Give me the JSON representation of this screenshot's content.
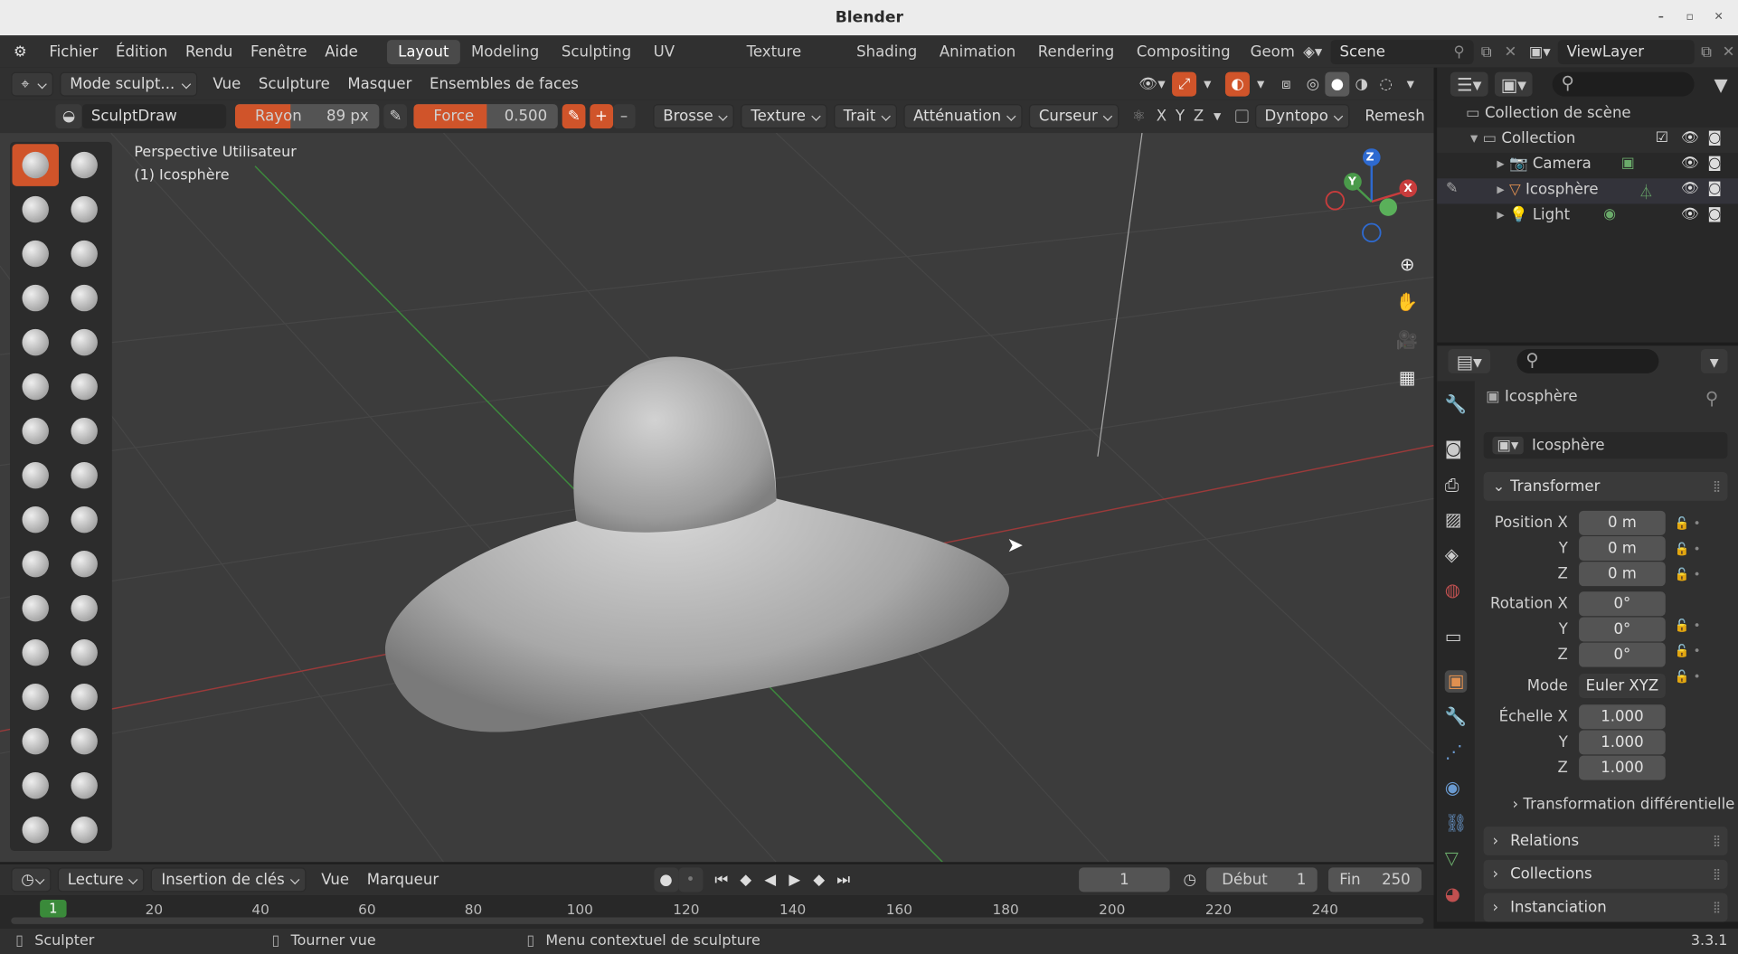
{
  "window": {
    "title": "Blender"
  },
  "menus": [
    "Fichier",
    "Édition",
    "Rendu",
    "Fenêtre",
    "Aide"
  ],
  "workspaces": [
    "Layout",
    "Modeling",
    "Sculpting",
    "UV Editing",
    "Texture Paint",
    "Shading",
    "Animation",
    "Rendering",
    "Compositing",
    "Geome"
  ],
  "scene": "Scene",
  "view_layer": "ViewLayer",
  "header": {
    "mode": "Mode sculpt...",
    "menus": [
      "Vue",
      "Sculpture",
      "Masquer",
      "Ensembles de faces"
    ]
  },
  "tool_settings": {
    "brush_name": "SculptDraw",
    "radius_label": "Rayon",
    "radius_value": "89 px",
    "strength_label": "Force",
    "strength_value": "0.500",
    "dropdowns": [
      "Brosse",
      "Texture",
      "Trait",
      "Atténuation",
      "Curseur"
    ],
    "axes": [
      "X",
      "Y",
      "Z"
    ],
    "dyntopo": "Dyntopo",
    "remesh": "Remesh"
  },
  "viewport": {
    "perspective": "Perspective Utilisateur",
    "object_label": "(1) Icosphère",
    "gizmo": {
      "x": "X",
      "y": "Y",
      "z": "Z"
    }
  },
  "outliner": {
    "root": "Collection de scène",
    "collection": "Collection",
    "items": [
      "Camera",
      "Icosphère",
      "Light"
    ]
  },
  "properties": {
    "object_name": "Icosphère",
    "data_name": "Icosphère",
    "transform_panel": "Transformer",
    "position_label": "Position X",
    "position": [
      "0 m",
      "0 m",
      "0 m"
    ],
    "rotation_label": "Rotation X",
    "rotation": [
      "0°",
      "0°",
      "0°"
    ],
    "mode_label": "Mode",
    "mode_value": "Euler XYZ",
    "scale_label": "Échelle X",
    "scale": [
      "1.000",
      "1.000",
      "1.000"
    ],
    "axis_y": "Y",
    "axis_z": "Z",
    "delta": "Transformation différentielle",
    "panels": [
      "Relations",
      "Collections",
      "Instanciation"
    ]
  },
  "timeline": {
    "menus": [
      "Lecture",
      "Insertion de clés",
      "Vue",
      "Marqueur"
    ],
    "current_frame": "1",
    "start_label": "Début",
    "start": "1",
    "end_label": "Fin",
    "end": "250",
    "ticks": [
      "1",
      "20",
      "40",
      "60",
      "80",
      "100",
      "120",
      "140",
      "160",
      "180",
      "200",
      "220",
      "240"
    ]
  },
  "statusbar": {
    "items": [
      "Sculpter",
      "Tourner vue",
      "Menu contextuel de sculpture"
    ],
    "version": "3.3.1"
  },
  "colors": {
    "accent": "#d0542a",
    "viewport": "#3c3c3c",
    "panel": "#303030"
  }
}
